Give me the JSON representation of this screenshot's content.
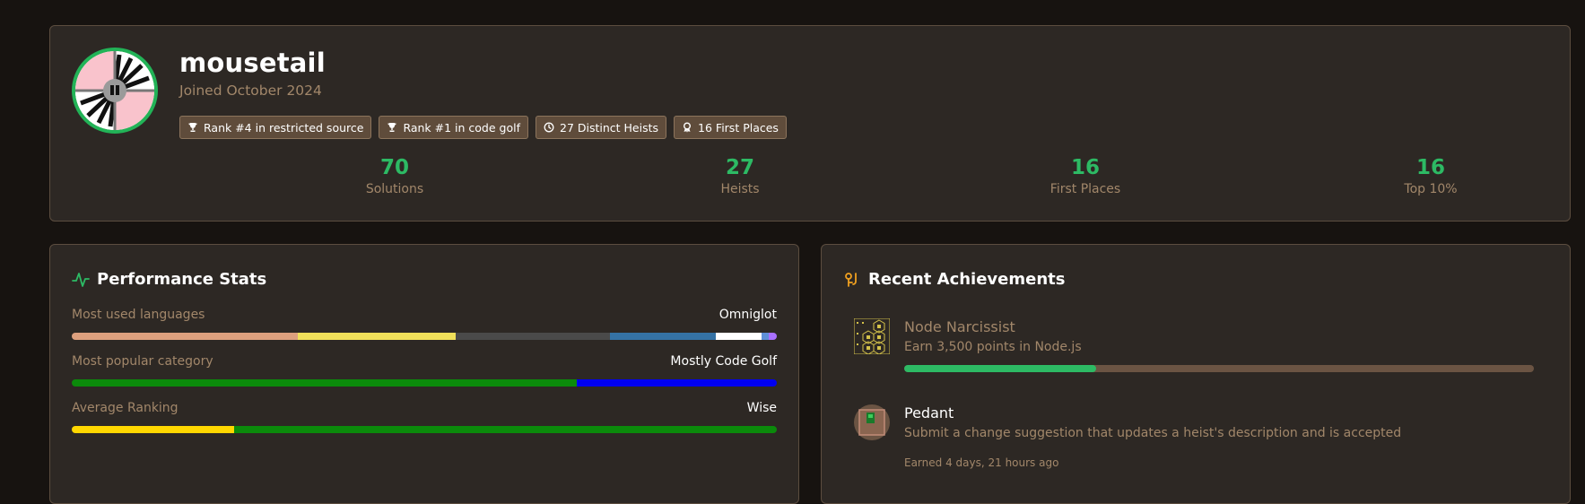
{
  "profile": {
    "username": "mousetail",
    "joined": "Joined October 2024",
    "badges": [
      {
        "icon": "trophy-icon",
        "label": "Rank #4 in restricted source"
      },
      {
        "icon": "trophy-icon",
        "label": "Rank #1 in code golf"
      },
      {
        "icon": "clock-icon",
        "label": "27 Distinct Heists"
      },
      {
        "icon": "medal-icon",
        "label": "16 First Places"
      }
    ],
    "stats": [
      {
        "value": "70",
        "label": "Solutions"
      },
      {
        "value": "27",
        "label": "Heists"
      },
      {
        "value": "16",
        "label": "First Places"
      },
      {
        "value": "16",
        "label": "Top 10%"
      }
    ]
  },
  "performance": {
    "title": "Performance Stats",
    "icon": "activity-icon",
    "rows": [
      {
        "label": "Most used languages",
        "value": "Omniglot",
        "segments": [
          {
            "color": "#dda07e",
            "fraction": 0.32
          },
          {
            "color": "#f0e05a",
            "fraction": 0.225
          },
          {
            "color": "#4a4a4a",
            "fraction": 0.218
          },
          {
            "color": "#3572a5",
            "fraction": 0.15
          },
          {
            "color": "#ffffff",
            "fraction": 0.065
          },
          {
            "color": "#5e8fd8",
            "fraction": 0.01
          },
          {
            "color": "#a970ff",
            "fraction": 0.012
          }
        ]
      },
      {
        "label": "Most popular category",
        "value": "Mostly Code Golf",
        "segments": [
          {
            "color": "#0b8a0b",
            "fraction": 0.716
          },
          {
            "color": "#0000f0",
            "fraction": 0.284
          }
        ]
      },
      {
        "label": "Average Ranking",
        "value": "Wise",
        "segments": [
          {
            "color": "#ffd700",
            "fraction": 0.23
          },
          {
            "color": "#0b8a0b",
            "fraction": 0.77
          }
        ]
      }
    ]
  },
  "achievements": {
    "title": "Recent Achievements",
    "icon": "award-icon",
    "items": [
      {
        "name": "Node Narcissist",
        "name_color": "#a2876a",
        "description": "Earn 3,500 points in Node.js",
        "progress": 0.305,
        "earned": ""
      },
      {
        "name": "Pedant",
        "name_color": "#ffffff",
        "description": "Submit a change suggestion that updates a heist's description and is accepted",
        "progress": null,
        "earned": "Earned 4 days, 21 hours ago"
      }
    ]
  },
  "colors": {
    "accent": "#2dba64",
    "muted": "#a2876a",
    "card": "#2d2824",
    "background": "#171310"
  }
}
